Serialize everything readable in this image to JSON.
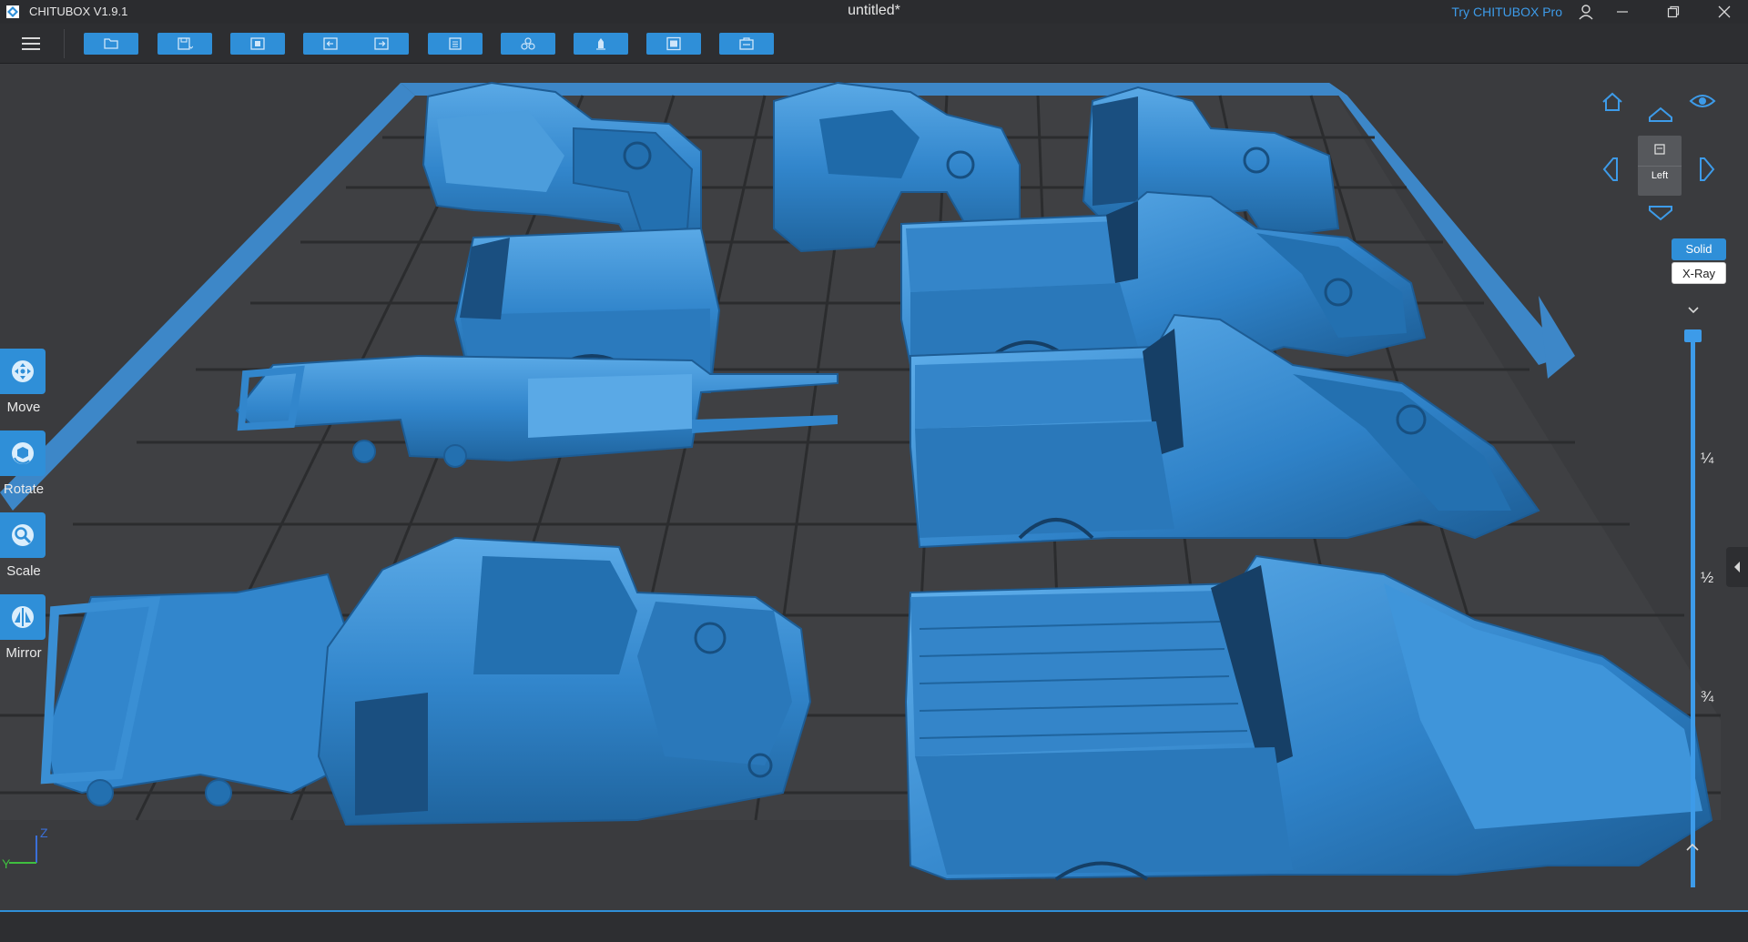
{
  "titlebar": {
    "app_title": "CHITUBOX V1.9.1",
    "document_title": "untitled*",
    "pro_link": "Try CHITUBOX Pro",
    "accent": "#3d9be9"
  },
  "toolbar": {
    "buttons": [
      {
        "name": "open-file-button",
        "icon": "folder-icon"
      },
      {
        "name": "save-button",
        "icon": "save-icon"
      },
      {
        "name": "auto-layout-button",
        "icon": "layout-icon"
      },
      {
        "name": "undo-button",
        "icon": "undo-icon"
      },
      {
        "name": "redo-button",
        "icon": "redo-icon"
      },
      {
        "name": "settings-button",
        "icon": "settings-icon"
      },
      {
        "name": "multi-model-button",
        "icon": "cubes-icon"
      },
      {
        "name": "support-button",
        "icon": "support-icon"
      },
      {
        "name": "hollow-button",
        "icon": "hollow-icon"
      },
      {
        "name": "slice-button",
        "icon": "slice-icon"
      }
    ],
    "button_color": "#2f8fd8"
  },
  "left_tools": [
    {
      "label": "Move",
      "icon": "move-icon"
    },
    {
      "label": "Rotate",
      "icon": "rotate-icon"
    },
    {
      "label": "Scale",
      "icon": "scale-icon"
    },
    {
      "label": "Mirror",
      "icon": "mirror-icon"
    }
  ],
  "view_controls": {
    "cube_label": "Left",
    "solid_label": "Solid",
    "xray_label": "X-Ray",
    "icons": [
      "home-icon",
      "view-top-icon",
      "eye-icon",
      "view-left-icon",
      "view-right-icon",
      "view-bottom-icon"
    ]
  },
  "layer_slider": {
    "marks": [
      "¼",
      "½",
      "¾"
    ],
    "level": 0
  },
  "axis_gizmo": {
    "z_label": "Z",
    "y_label": "Y"
  },
  "scene": {
    "plate_color": "#3f4043",
    "plate_grid": "#2a2b2d",
    "plate_border": "#3d87c8",
    "model_color": "#3286cc",
    "model_highlight": "#59a9e6",
    "model_shadow": "#1d5c94"
  }
}
